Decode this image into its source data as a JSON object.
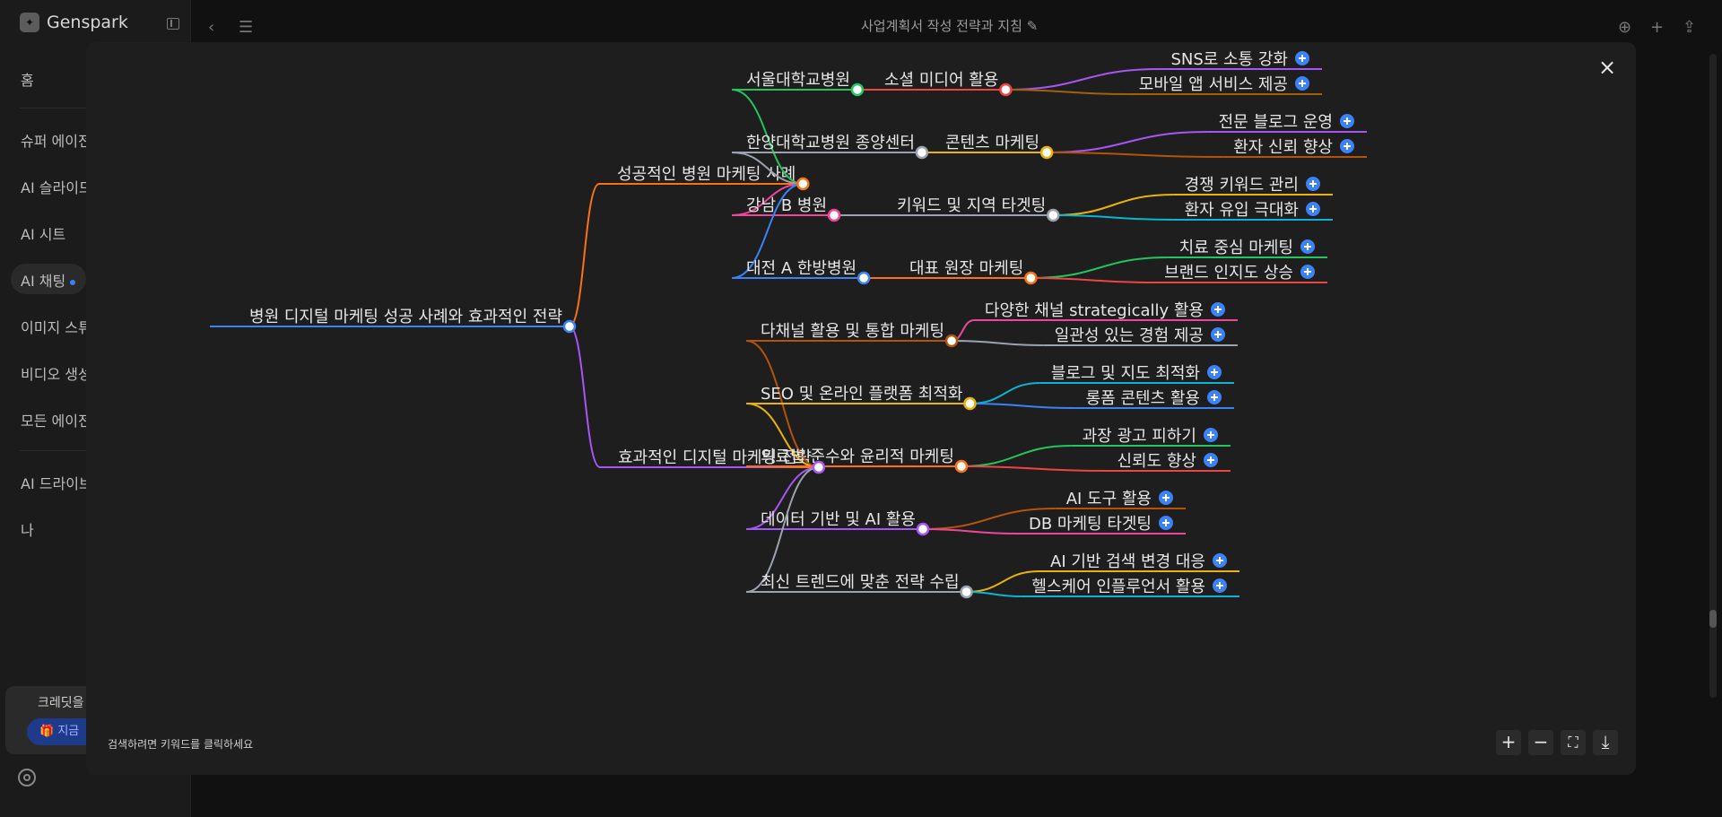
{
  "app": {
    "brand": "Genspark"
  },
  "sidebar": {
    "items": [
      {
        "label": "홈"
      },
      {
        "label": "슈퍼 에이전"
      },
      {
        "label": "AI 슬라이드"
      },
      {
        "label": "AI 시트"
      },
      {
        "label": "AI 채팅"
      },
      {
        "label": "이미지 스튜"
      },
      {
        "label": "비디오 생성"
      },
      {
        "label": "모든 에이전"
      },
      {
        "label": "AI 드라이브"
      },
      {
        "label": "나"
      }
    ],
    "credit": {
      "text": "크레딧을",
      "button": "지금"
    }
  },
  "header": {
    "title": "사업계획서 작성 전략과 지침"
  },
  "modal": {
    "hint": "검색하려면 키워드를 클릭하세요",
    "mindmap": {
      "root": {
        "label": "병원 디지털 마케팅 성공 사례와 효과적인 전략",
        "color": "#3b82f6"
      },
      "groups": [
        {
          "label": "성공적인 병원 마케팅 사례",
          "color": "#f97316",
          "branches": [
            {
              "label": "서울대학교병원",
              "color": "#22c55e",
              "sub": {
                "label": "소셜 미디어 활용",
                "color": "#ef4444",
                "leaves": [
                  {
                    "label": "SNS로 소통 강화",
                    "color": "#a855f7"
                  },
                  {
                    "label": "모바일 앱 서비스 제공",
                    "color": "#a16207"
                  }
                ]
              }
            },
            {
              "label": "한양대학교병원 종양센터",
              "color": "#9ca3af",
              "sub": {
                "label": "콘텐츠 마케팅",
                "color": "#eab308",
                "leaves": [
                  {
                    "label": "전문 블로그 운영",
                    "color": "#a855f7"
                  },
                  {
                    "label": "환자 신뢰 향상",
                    "color": "#b45309"
                  }
                ]
              }
            },
            {
              "label": "강남 B 병원",
              "color": "#ec4899",
              "sub": {
                "label": "키워드 및 지역 타겟팅",
                "color": "#9ca3af",
                "leaves": [
                  {
                    "label": "경쟁 키워드 관리",
                    "color": "#eab308"
                  },
                  {
                    "label": "환자 유입 극대화",
                    "color": "#06b6d4"
                  }
                ]
              }
            },
            {
              "label": "대전 A 한방병원",
              "color": "#3b82f6",
              "sub": {
                "label": "대표 원장 마케팅",
                "color": "#f97316",
                "leaves": [
                  {
                    "label": "치료 중심 마케팅",
                    "color": "#22c55e"
                  },
                  {
                    "label": "브랜드 인지도 상승",
                    "color": "#ef4444"
                  }
                ]
              }
            }
          ]
        },
        {
          "label": "효과적인 디지털 마케팅 전략",
          "color": "#a855f7",
          "branches": [
            {
              "label": "다채널 활용 및 통합 마케팅",
              "color": "#b45309",
              "leaves": [
                {
                  "label": "다양한 채널 strategically 활용",
                  "color": "#ec4899"
                },
                {
                  "label": "일관성 있는 경험 제공",
                  "color": "#9ca3af"
                }
              ]
            },
            {
              "label": "SEO 및 온라인 플랫폼 최적화",
              "color": "#eab308",
              "leaves": [
                {
                  "label": "블로그 및 지도 최적화",
                  "color": "#06b6d4"
                },
                {
                  "label": "롱폼 콘텐츠 활용",
                  "color": "#3b82f6"
                }
              ]
            },
            {
              "label": "의료법 준수와 윤리적 마케팅",
              "color": "#f97316",
              "leaves": [
                {
                  "label": "과장 광고 피하기",
                  "color": "#22c55e"
                },
                {
                  "label": "신뢰도 향상",
                  "color": "#ef4444"
                }
              ]
            },
            {
              "label": "데이터 기반 및 AI 활용",
              "color": "#a855f7",
              "leaves": [
                {
                  "label": "AI 도구 활용",
                  "color": "#b45309"
                },
                {
                  "label": "DB 마케팅 타겟팅",
                  "color": "#ec4899"
                }
              ]
            },
            {
              "label": "최신 트렌드에 맞춘 전략 수립",
              "color": "#9ca3af",
              "leaves": [
                {
                  "label": "AI 기반 검색 변경 대응",
                  "color": "#eab308"
                },
                {
                  "label": "헬스케어 인플루언서 활용",
                  "color": "#06b6d4"
                }
              ]
            }
          ]
        }
      ]
    },
    "controls": {
      "zoom_in": "+",
      "zoom_out": "−",
      "fit": "⛶",
      "download": "⤓"
    },
    "close": "×"
  }
}
